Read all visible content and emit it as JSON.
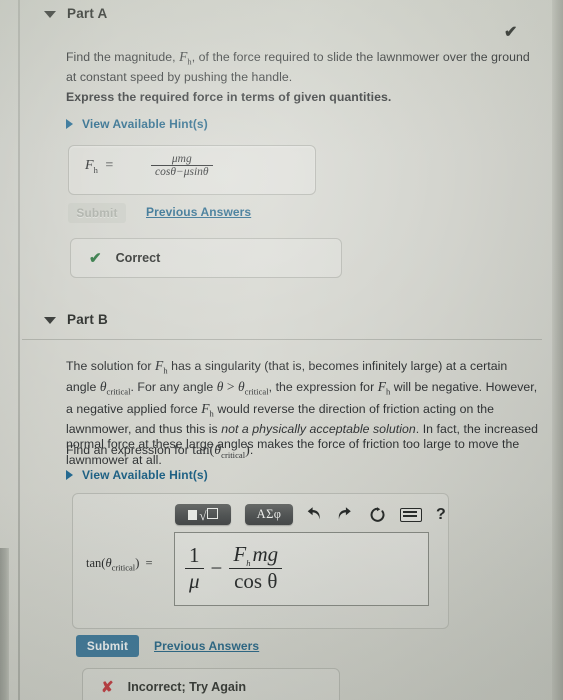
{
  "page": {
    "background_color": "#cfd0c9",
    "accent_link_color": "#12597f",
    "submit_button_color": "#2b6c93",
    "correct_color": "#1d6b32",
    "incorrect_color": "#c0222a"
  },
  "part_a": {
    "header_label": "Part A",
    "status_check_icon": "✔",
    "question_line1": "Find the magnitude, ",
    "question_symbol": "F",
    "question_symbol_sub": "h",
    "question_line1_cont": ", of the force required to slide the lawnmower over the ground at",
    "question_line2": "constant speed by pushing the handle.",
    "instruction": "Express the required force in terms of given quantities.",
    "hint_label": "View Available Hint(s)",
    "answer": {
      "lhs_symbol": "F",
      "lhs_sub": "h",
      "equals": "=",
      "numerator": "μmg",
      "denominator": "cosθ−μsinθ"
    },
    "submit_label": "Submit",
    "submit_disabled": true,
    "previous_answers_label": "Previous Answers",
    "feedback_icon": "✔",
    "feedback_label": "Correct"
  },
  "part_b": {
    "header_label": "Part B",
    "paragraph": {
      "l1_a": "The solution for ",
      "l1_sym": "F",
      "l1_sub": "h",
      "l1_b": " has a singularity (that is, becomes infinitely large) at a certain angle",
      "l2_sym1": "θ",
      "l2_sub1": "critical",
      "l2_a": ". For any angle ",
      "l2_sym2": "θ",
      "l2_gt": " > ",
      "l2_sym3": "θ",
      "l2_sub3": "critical",
      "l2_b": ", the expression for ",
      "l2_sym4": "F",
      "l2_sub4": "h",
      "l2_c": " will be negative. However, a",
      "l3_a": "negative applied force ",
      "l3_sym": "F",
      "l3_sub": "h",
      "l3_b": " would reverse the direction of friction acting on the lawnmower,",
      "l4_a": "and thus this is ",
      "l4_italic": "not a physically acceptable solution",
      "l4_b": ". In fact, the increased normal force at",
      "l5": "these large angles makes the force of friction too large to move the lawnmower at all."
    },
    "find_prompt_a": "Find an expression for ",
    "find_prompt_fn": "tan(",
    "find_prompt_sym": "θ",
    "find_prompt_sub": "critical",
    "find_prompt_close": ")",
    "find_prompt_end": ".",
    "hint_label": "View Available Hint(s)",
    "toolbar": {
      "template_icon": "math-template-icon",
      "template_root_glyph": "√",
      "greek_label": "ΑΣφ",
      "undo_glyph": "↶",
      "redo_glyph": "↷",
      "reset_glyph": "↺",
      "keyboard_icon": "keyboard-icon",
      "help_glyph": "?"
    },
    "answer": {
      "lhs_fn": "tan(",
      "lhs_sym": "θ",
      "lhs_sub": "critical",
      "lhs_close": ")",
      "equals": "=",
      "term1_num": "1",
      "term1_den": "μ",
      "operator": "−",
      "term2_num_sym": "F",
      "term2_num_sub": "h",
      "term2_num_rest": "mg",
      "term2_den": "cos θ"
    },
    "submit_label": "Submit",
    "previous_answers_label": "Previous Answers",
    "feedback_icon": "✘",
    "feedback_label": "Incorrect; Try Again"
  }
}
